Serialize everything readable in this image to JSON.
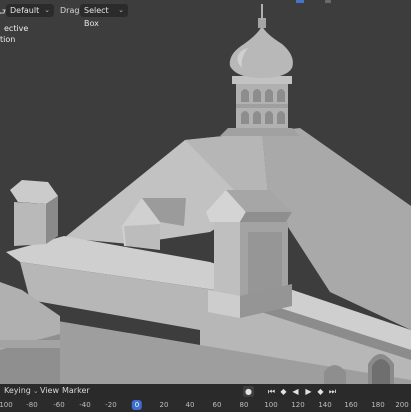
{
  "header": {
    "mode_dropdown": "Default",
    "drag_label": "Drag:",
    "drag_dropdown": "Select Box"
  },
  "overlay": {
    "view_line1": "ective",
    "view_line2": "tion"
  },
  "timeline": {
    "menus": [
      "Keying",
      "View",
      "Marker"
    ],
    "frame_ticks": [
      "100",
      "-80",
      "-60",
      "-40",
      "-20",
      "0",
      "20",
      "40",
      "60",
      "80",
      "100",
      "120",
      "140",
      "160",
      "180",
      "200"
    ],
    "current_frame": "0"
  },
  "colors": {
    "viewport_bg": "#3d3d3d",
    "model_light": "#bdbdbd",
    "model_mid": "#a8a8a8",
    "model_dark": "#7e7e7e",
    "accent": "#3c6fd1"
  },
  "icons": {
    "editor_type": "arrow-left-icon",
    "play_controls": [
      "record-dot-icon",
      "jump-start-icon",
      "prev-keyframe-icon",
      "play-reverse-icon",
      "play-icon",
      "next-keyframe-icon",
      "jump-end-icon"
    ]
  }
}
